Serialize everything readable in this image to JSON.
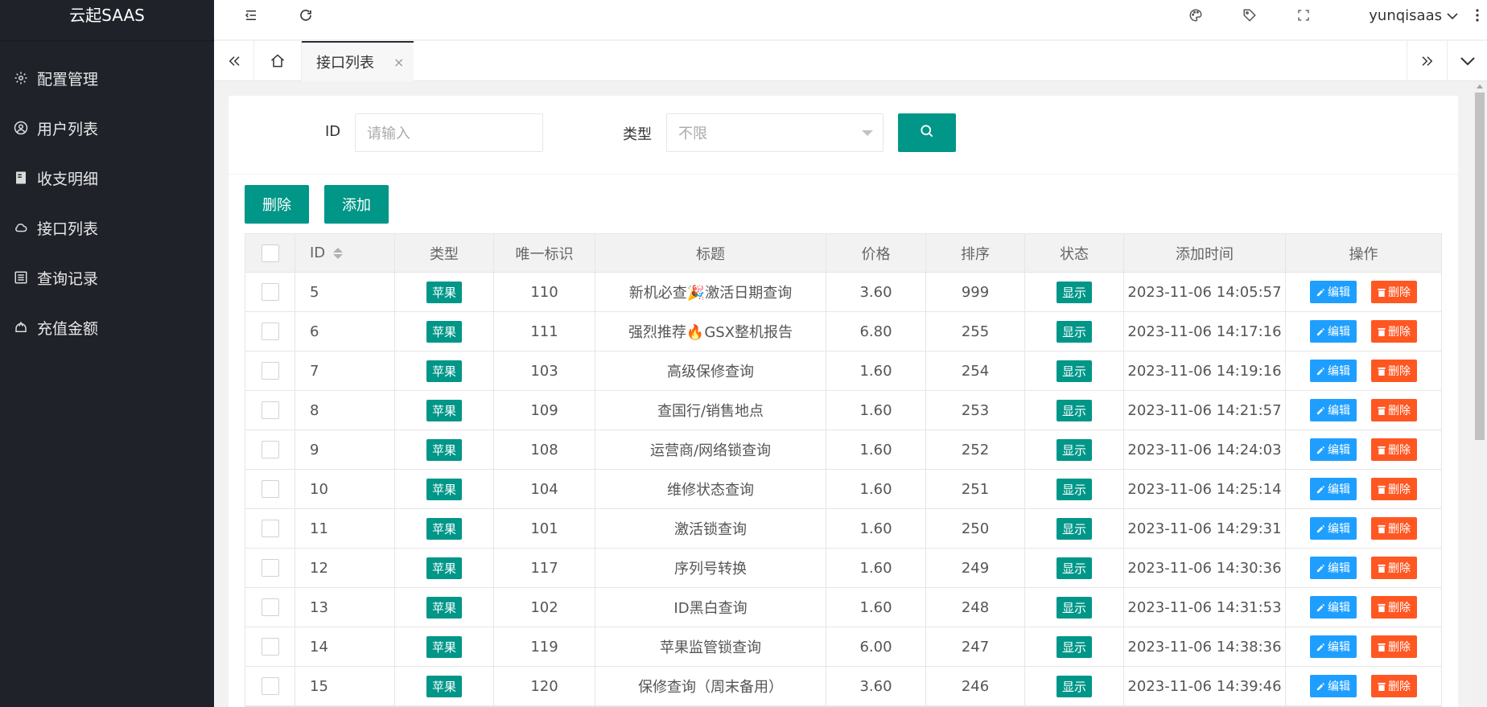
{
  "app": {
    "title": "云起SAAS"
  },
  "sidebar": {
    "items": [
      {
        "label": "配置管理",
        "icon": "gear-icon"
      },
      {
        "label": "用户列表",
        "icon": "user-icon"
      },
      {
        "label": "收支明细",
        "icon": "ledger-icon"
      },
      {
        "label": "接口列表",
        "icon": "cloud-icon"
      },
      {
        "label": "查询记录",
        "icon": "list-icon"
      },
      {
        "label": "充值金额",
        "icon": "wallet-icon"
      }
    ]
  },
  "header": {
    "username": "yunqisaas"
  },
  "tabs": {
    "active_label": "接口列表",
    "close_glyph": "×"
  },
  "search": {
    "id_label": "ID",
    "id_placeholder": "请输入",
    "type_label": "类型",
    "type_value": "不限"
  },
  "toolbar": {
    "delete_label": "删除",
    "add_label": "添加"
  },
  "table": {
    "columns": [
      "ID",
      "类型",
      "唯一标识",
      "标题",
      "价格",
      "排序",
      "状态",
      "添加时间",
      "操作"
    ],
    "edit_label": "编辑",
    "delete_label": "删除",
    "rows": [
      {
        "id": "5",
        "type": "苹果",
        "uid": "110",
        "title": "新机必查🎉激活日期查询",
        "price": "3.60",
        "sort": "999",
        "status": "显示",
        "time": "2023-11-06 14:05:57"
      },
      {
        "id": "6",
        "type": "苹果",
        "uid": "111",
        "title": "强烈推荐🔥GSX整机报告",
        "price": "6.80",
        "sort": "255",
        "status": "显示",
        "time": "2023-11-06 14:17:16"
      },
      {
        "id": "7",
        "type": "苹果",
        "uid": "103",
        "title": "高级保修查询",
        "price": "1.60",
        "sort": "254",
        "status": "显示",
        "time": "2023-11-06 14:19:16"
      },
      {
        "id": "8",
        "type": "苹果",
        "uid": "109",
        "title": "查国行/销售地点",
        "price": "1.60",
        "sort": "253",
        "status": "显示",
        "time": "2023-11-06 14:21:57"
      },
      {
        "id": "9",
        "type": "苹果",
        "uid": "108",
        "title": "运营商/网络锁查询",
        "price": "1.60",
        "sort": "252",
        "status": "显示",
        "time": "2023-11-06 14:24:03"
      },
      {
        "id": "10",
        "type": "苹果",
        "uid": "104",
        "title": "维修状态查询",
        "price": "1.60",
        "sort": "251",
        "status": "显示",
        "time": "2023-11-06 14:25:14"
      },
      {
        "id": "11",
        "type": "苹果",
        "uid": "101",
        "title": "激活锁查询",
        "price": "1.60",
        "sort": "250",
        "status": "显示",
        "time": "2023-11-06 14:29:31"
      },
      {
        "id": "12",
        "type": "苹果",
        "uid": "117",
        "title": "序列号转换",
        "price": "1.60",
        "sort": "249",
        "status": "显示",
        "time": "2023-11-06 14:30:36"
      },
      {
        "id": "13",
        "type": "苹果",
        "uid": "102",
        "title": "ID黑白查询",
        "price": "1.60",
        "sort": "248",
        "status": "显示",
        "time": "2023-11-06 14:31:53"
      },
      {
        "id": "14",
        "type": "苹果",
        "uid": "119",
        "title": "苹果监管锁查询",
        "price": "6.00",
        "sort": "247",
        "status": "显示",
        "time": "2023-11-06 14:38:36"
      },
      {
        "id": "15",
        "type": "苹果",
        "uid": "120",
        "title": "保修查询（周末备用）",
        "price": "3.60",
        "sort": "246",
        "status": "显示",
        "time": "2023-11-06 14:39:46"
      }
    ]
  },
  "colors": {
    "primary": "#009688",
    "edit": "#1e9fff",
    "delete": "#ff5722",
    "sidebar_bg": "#20222a"
  }
}
